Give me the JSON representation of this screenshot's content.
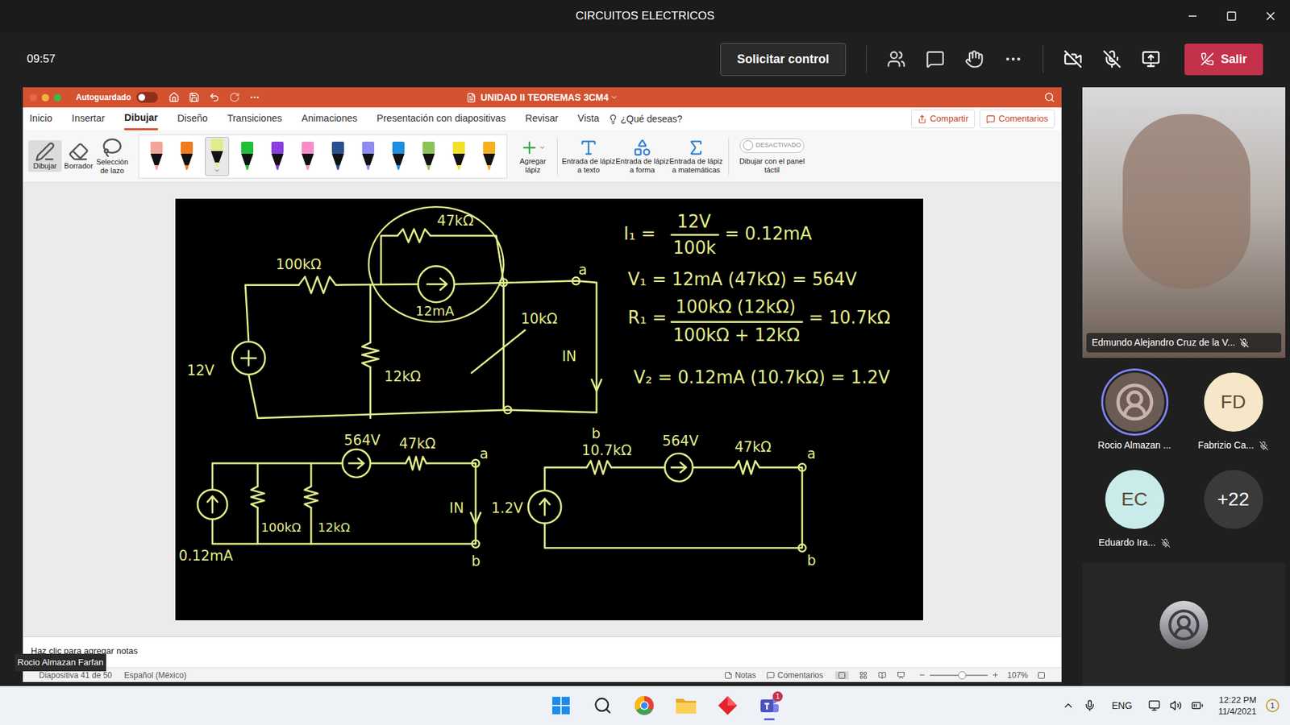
{
  "window": {
    "title": "CIRCUITOS ELECTRICOS"
  },
  "meeting_bar": {
    "time": "09:57",
    "request_control": "Solicitar control",
    "leave": "Salir",
    "camera_on": false,
    "mic_on": false
  },
  "presentation": {
    "autosave": {
      "label": "Autoguardado",
      "on": false
    },
    "file_title": "UNIDAD II TEOREMAS 3CM4",
    "tabs": [
      {
        "label": "Inicio",
        "selected": false
      },
      {
        "label": "Insertar",
        "selected": false
      },
      {
        "label": "Dibujar",
        "selected": true
      },
      {
        "label": "Diseño",
        "selected": false
      },
      {
        "label": "Transiciones",
        "selected": false
      },
      {
        "label": "Animaciones",
        "selected": false
      },
      {
        "label": "Presentación con diapositivas",
        "selected": false
      },
      {
        "label": "Revisar",
        "selected": false
      },
      {
        "label": "Vista",
        "selected": false
      }
    ],
    "search_prompt": "¿Qué deseas?",
    "share": "Compartir",
    "comments": "Comentarios",
    "tools": [
      {
        "label": "Dibujar",
        "selected": true
      },
      {
        "label": "Borrador",
        "selected": false
      },
      {
        "label": "Selección de lazo",
        "selected": false
      }
    ],
    "pens": [
      {
        "color": "#f2a59b",
        "selected": false
      },
      {
        "color": "#f07c1e",
        "selected": false
      },
      {
        "color": "#e3ec8a",
        "selected": true
      },
      {
        "color": "#22c03a",
        "selected": false
      },
      {
        "color": "#8a3ee0",
        "selected": false
      },
      {
        "color": "#f58ec8",
        "selected": false
      },
      {
        "color": "#2b4f8f",
        "selected": false
      },
      {
        "color": "#8f8cf0",
        "selected": false
      },
      {
        "color": "#1c8fe0",
        "selected": false
      },
      {
        "color": "#8cc45a",
        "selected": false
      },
      {
        "color": "#f2e12a",
        "selected": false
      },
      {
        "color": "#f2b21e",
        "selected": false
      }
    ],
    "add_pen": "Agregar lápiz",
    "ink_actions": [
      "Entrada de lápiz a texto",
      "Entrada de lápiz a forma",
      "Entrada de lápiz a matemáticas"
    ],
    "touch_drawing": {
      "state_label": "DESACTIVADO",
      "label": "Dibujar con el panel táctil",
      "on": false
    },
    "slide": {
      "ink_texts": [
        "47kΩ",
        "100kΩ",
        "12mA",
        "10kΩ",
        "IN",
        "12V",
        "12kΩ",
        "a",
        "b",
        "564V",
        "47kΩ",
        "100kΩ",
        "12kΩ",
        "IN",
        "0.12mA",
        "a",
        "b",
        "10.7kΩ",
        "564V",
        "47kΩ",
        "a",
        "1.2V",
        "b",
        "I₁ =",
        "12V",
        "100k",
        "= 0.12mA",
        "V₁ = 12mA (47kΩ) = 564V",
        "R₁ =",
        "100kΩ (12kΩ)",
        "100kΩ + 12kΩ",
        "= 10.7kΩ",
        "V₂ = 0.12mA (10.7kΩ) = 1.2V"
      ]
    },
    "notes_placeholder": "Haz clic para agregar notas",
    "status_bar": {
      "slide": "Diapositiva 41 de 50",
      "language": "Español (México)",
      "notes": "Notas",
      "comments": "Comentarios",
      "zoom": "107%",
      "zoom_level": 0.55
    }
  },
  "presenter_label": "Rocio Almazan Farfan",
  "participants": {
    "main_video": {
      "name": "Edmundo Alejandro Cruz de la V...",
      "muted": true
    },
    "tiles": [
      {
        "kind": "photo",
        "initials": "",
        "name": "Rocio Almazan ...",
        "speaking": true,
        "muted": false,
        "color": "#6b5b55"
      },
      {
        "kind": "initials",
        "initials": "FD",
        "name": "Fabrizio Ca...",
        "speaking": false,
        "muted": true,
        "color": "#f6e7c9"
      },
      {
        "kind": "initials",
        "initials": "EC",
        "name": "Eduardo Ira...",
        "speaking": false,
        "muted": true,
        "color": "#c9ecea"
      },
      {
        "kind": "overflow",
        "initials": "+22",
        "name": "",
        "speaking": false,
        "muted": false,
        "color": "#3a3a3a"
      }
    ]
  },
  "taskbar": {
    "apps": [
      {
        "running": false,
        "badge": ""
      },
      {
        "running": false,
        "badge": ""
      },
      {
        "running": false,
        "badge": ""
      },
      {
        "running": false,
        "badge": ""
      },
      {
        "running": false,
        "badge": ""
      },
      {
        "running": true,
        "badge": "1"
      }
    ],
    "language": "ENG",
    "time": "12:22 PM",
    "date": "11/4/2021",
    "notifications": "1"
  }
}
